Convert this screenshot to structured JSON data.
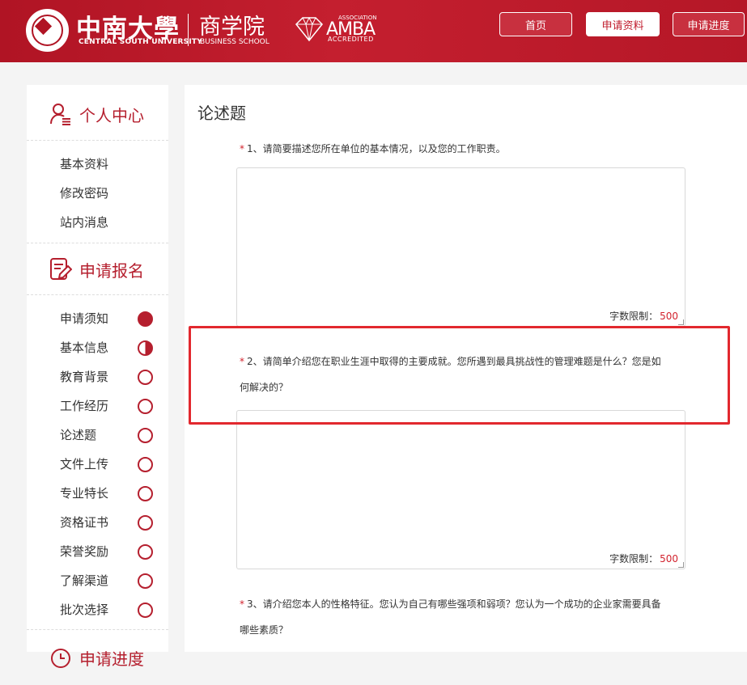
{
  "header": {
    "university_cn": "中南大學",
    "university_en": "CENTRAL SOUTH UNIVERSITY",
    "school_cn": "商学院",
    "school_en": "BUSINESS SCHOOL",
    "amba_small": "ASSOCIATION",
    "amba_big": "AMBA",
    "amba_sub": "ACCREDITED",
    "nav": {
      "home": "首页",
      "apply": "申请资料",
      "progress": "申请进度"
    },
    "colors": {
      "brand": "#b51f2e",
      "accent": "#d2222d"
    }
  },
  "sidebar": {
    "personal_title": "个人中心",
    "personal_icon": "user-list-icon",
    "personal_items": [
      {
        "label": "基本资料"
      },
      {
        "label": "修改密码"
      },
      {
        "label": "站内消息"
      }
    ],
    "apply_title": "申请报名",
    "apply_icon": "form-edit-icon",
    "apply_items": [
      {
        "label": "申请须知",
        "status": "complete"
      },
      {
        "label": "基本信息",
        "status": "partial"
      },
      {
        "label": "教育背景",
        "status": "empty"
      },
      {
        "label": "工作经历",
        "status": "empty"
      },
      {
        "label": "论述题",
        "status": "empty"
      },
      {
        "label": "文件上传",
        "status": "empty"
      },
      {
        "label": "专业特长",
        "status": "empty"
      },
      {
        "label": "资格证书",
        "status": "empty"
      },
      {
        "label": "荣誉奖励",
        "status": "empty"
      },
      {
        "label": "了解渠道",
        "status": "empty"
      },
      {
        "label": "批次选择",
        "status": "empty"
      }
    ],
    "progress_title": "申请进度"
  },
  "main": {
    "title": "论述题",
    "required_mark": "*",
    "limit_label": "字数限制：",
    "questions": [
      {
        "line1": "1、请简要描述您所在单位的基本情况，以及您的工作职责。",
        "line2": "",
        "limit": "500",
        "value": ""
      },
      {
        "line1": "2、请简单介绍您在职业生涯中取得的主要成就。您所遇到最具挑战性的管理难题是什么？您是如",
        "line2": "何解决的？",
        "limit": "500",
        "value": ""
      },
      {
        "line1": "3、请介绍您本人的性格特征。您认为自己有哪些强项和弱项？您认为一个成功的企业家需要具备",
        "line2": "哪些素质？",
        "limit": "",
        "value": ""
      }
    ]
  }
}
